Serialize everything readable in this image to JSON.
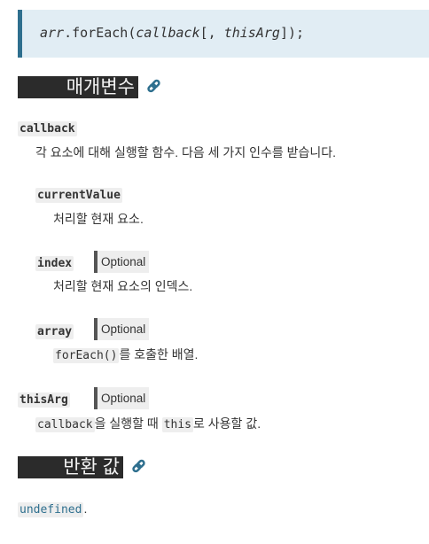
{
  "syntax": {
    "obj": "arr",
    "method": ".forEach(",
    "arg1": "callback",
    "sep": "[, ",
    "arg2": "thisArg",
    "end": "]);"
  },
  "headings": {
    "params": "매개변수",
    "returns": "반환 값"
  },
  "params": [
    {
      "name": "callback",
      "desc": "각 요소에 대해 실행할 함수. 다음 세 가지 인수를 받습니다."
    },
    {
      "name": "currentValue",
      "desc": "처리할 현재 요소."
    },
    {
      "name": "index",
      "badge": "Optional",
      "desc": "처리할 현재 요소의 인덱스."
    },
    {
      "name": "array",
      "badge": "Optional",
      "desc_code": "forEach()",
      "desc": "를 호출한 배열."
    },
    {
      "name": "thisArg",
      "badge": "Optional",
      "desc_code1": "callback",
      "desc1": "을 실행할 때 ",
      "desc_code2": "this",
      "desc2": "로 사용할 값."
    }
  ],
  "returns": {
    "value": "undefined",
    "suffix": "."
  }
}
